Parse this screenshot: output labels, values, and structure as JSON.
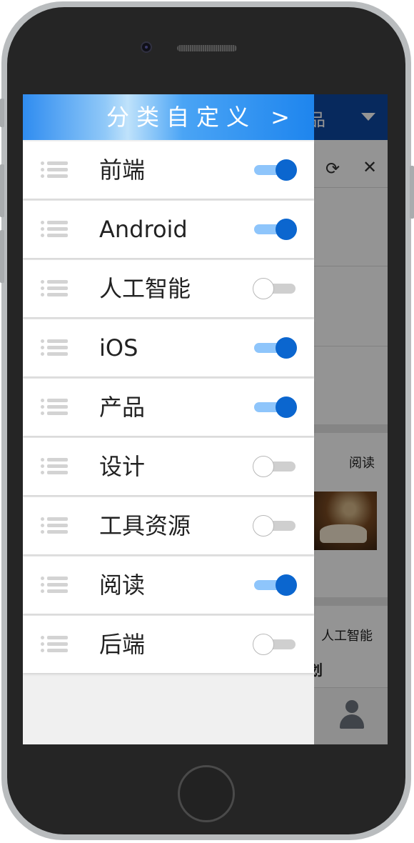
{
  "drawer": {
    "title": "分类自定义 >",
    "categories": [
      {
        "label": "前端",
        "enabled": true
      },
      {
        "label": "Android",
        "enabled": true
      },
      {
        "label": "人工智能",
        "enabled": false
      },
      {
        "label": "iOS",
        "enabled": true
      },
      {
        "label": "产品",
        "enabled": true
      },
      {
        "label": "设计",
        "enabled": false
      },
      {
        "label": "工具资源",
        "enabled": false
      },
      {
        "label": "阅读",
        "enabled": true
      },
      {
        "label": "后端",
        "enabled": false
      }
    ]
  },
  "background_app": {
    "header_partial_text": "品",
    "tag_reading": "阅读",
    "tag_ai": "人工智能",
    "partial_title": "划"
  },
  "colors": {
    "toggle_on": "#0b66cf",
    "toggle_track_on": "#8ec5fb",
    "header_accent": "#2f8cf0"
  }
}
